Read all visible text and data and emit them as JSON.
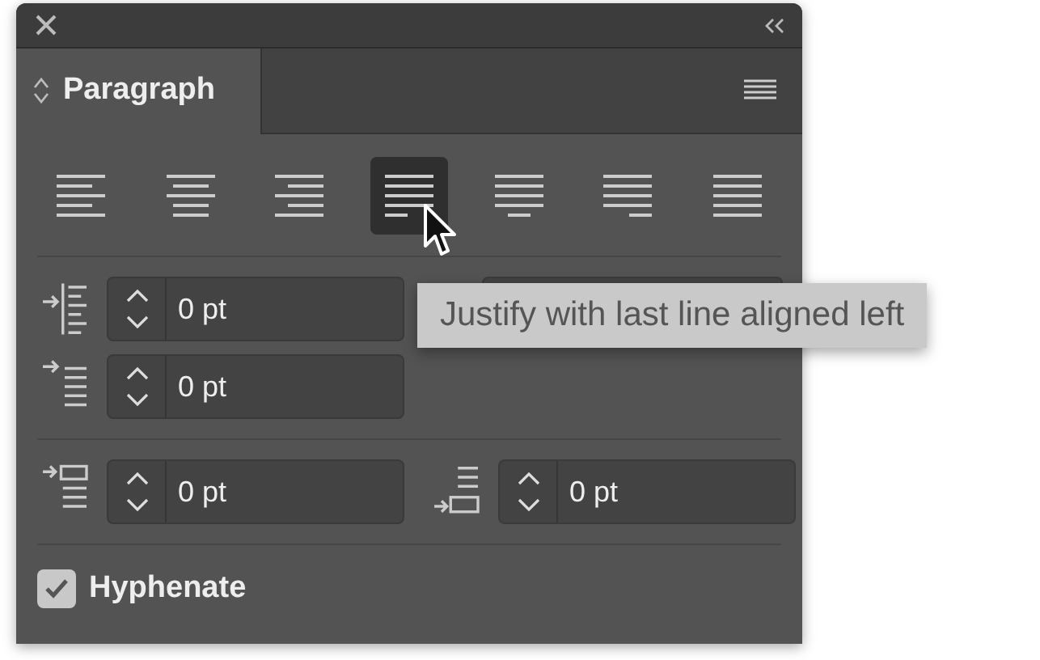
{
  "tab": {
    "label": "Paragraph",
    "selected": true
  },
  "alignment_buttons": [
    {
      "kind": "left",
      "selected": false
    },
    {
      "kind": "center",
      "selected": false
    },
    {
      "kind": "right",
      "selected": false
    },
    {
      "kind": "justify-left",
      "selected": true
    },
    {
      "kind": "justify-center",
      "selected": false
    },
    {
      "kind": "justify-right",
      "selected": false
    },
    {
      "kind": "justify-all",
      "selected": false
    }
  ],
  "tooltip": {
    "text": "Justify with last line aligned left"
  },
  "indent_fields": [
    {
      "kind": "left-indent",
      "value": "0 pt"
    },
    {
      "kind": "first-line-indent",
      "value": "0 pt"
    }
  ],
  "spacing_fields": [
    {
      "kind": "space-before",
      "value": "0 pt"
    },
    {
      "kind": "space-after",
      "value": "0 pt"
    }
  ],
  "hyphenate": {
    "label": "Hyphenate",
    "checked": true
  }
}
